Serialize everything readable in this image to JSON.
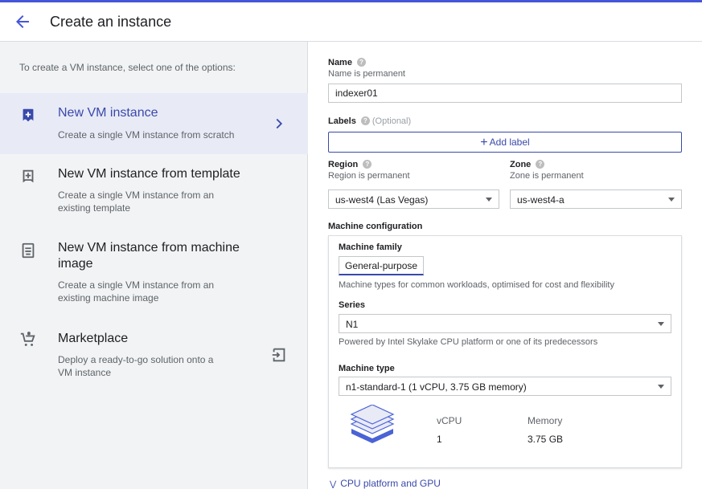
{
  "header": {
    "title": "Create an instance",
    "back_icon": "arrow-left-icon",
    "accent": "#4556d8"
  },
  "left": {
    "intro": "To create a VM instance, select one of the options:",
    "options": [
      {
        "title": "New VM instance",
        "desc": "Create a single VM instance from scratch",
        "icon": "add-box-icon",
        "active": true
      },
      {
        "title": "New VM instance from template",
        "desc": "Create a single VM instance from an existing template",
        "icon": "template-icon"
      },
      {
        "title": "New VM instance from machine image",
        "desc": "Create a single VM instance from an existing machine image",
        "icon": "machine-image-icon"
      },
      {
        "title": "Marketplace",
        "desc": "Deploy a ready-to-go solution onto a VM instance",
        "icon": "cart-icon"
      }
    ]
  },
  "form": {
    "name": {
      "label": "Name",
      "sub": "Name is permanent",
      "value": "indexer01"
    },
    "labels": {
      "label": "Labels",
      "optional": "(Optional)",
      "add_button": "Add label"
    },
    "region": {
      "label": "Region",
      "sub": "Region is permanent",
      "value": "us-west4 (Las Vegas)"
    },
    "zone": {
      "label": "Zone",
      "sub": "Zone is permanent",
      "value": "us-west4-a"
    },
    "machine_config": {
      "label": "Machine configuration",
      "family_label": "Machine family",
      "family_value": "General-purpose",
      "family_desc": "Machine types for common workloads, optimised for cost and flexibility",
      "series_label": "Series",
      "series_value": "N1",
      "series_desc": "Powered by Intel Skylake CPU platform or one of its predecessors",
      "type_label": "Machine type",
      "type_value": "n1-standard-1 (1 vCPU, 3.75 GB memory)",
      "vcpu_header": "vCPU",
      "vcpu_value": "1",
      "memory_header": "Memory",
      "memory_value": "3.75 GB"
    },
    "cpu_platform_link": "CPU platform and GPU"
  }
}
